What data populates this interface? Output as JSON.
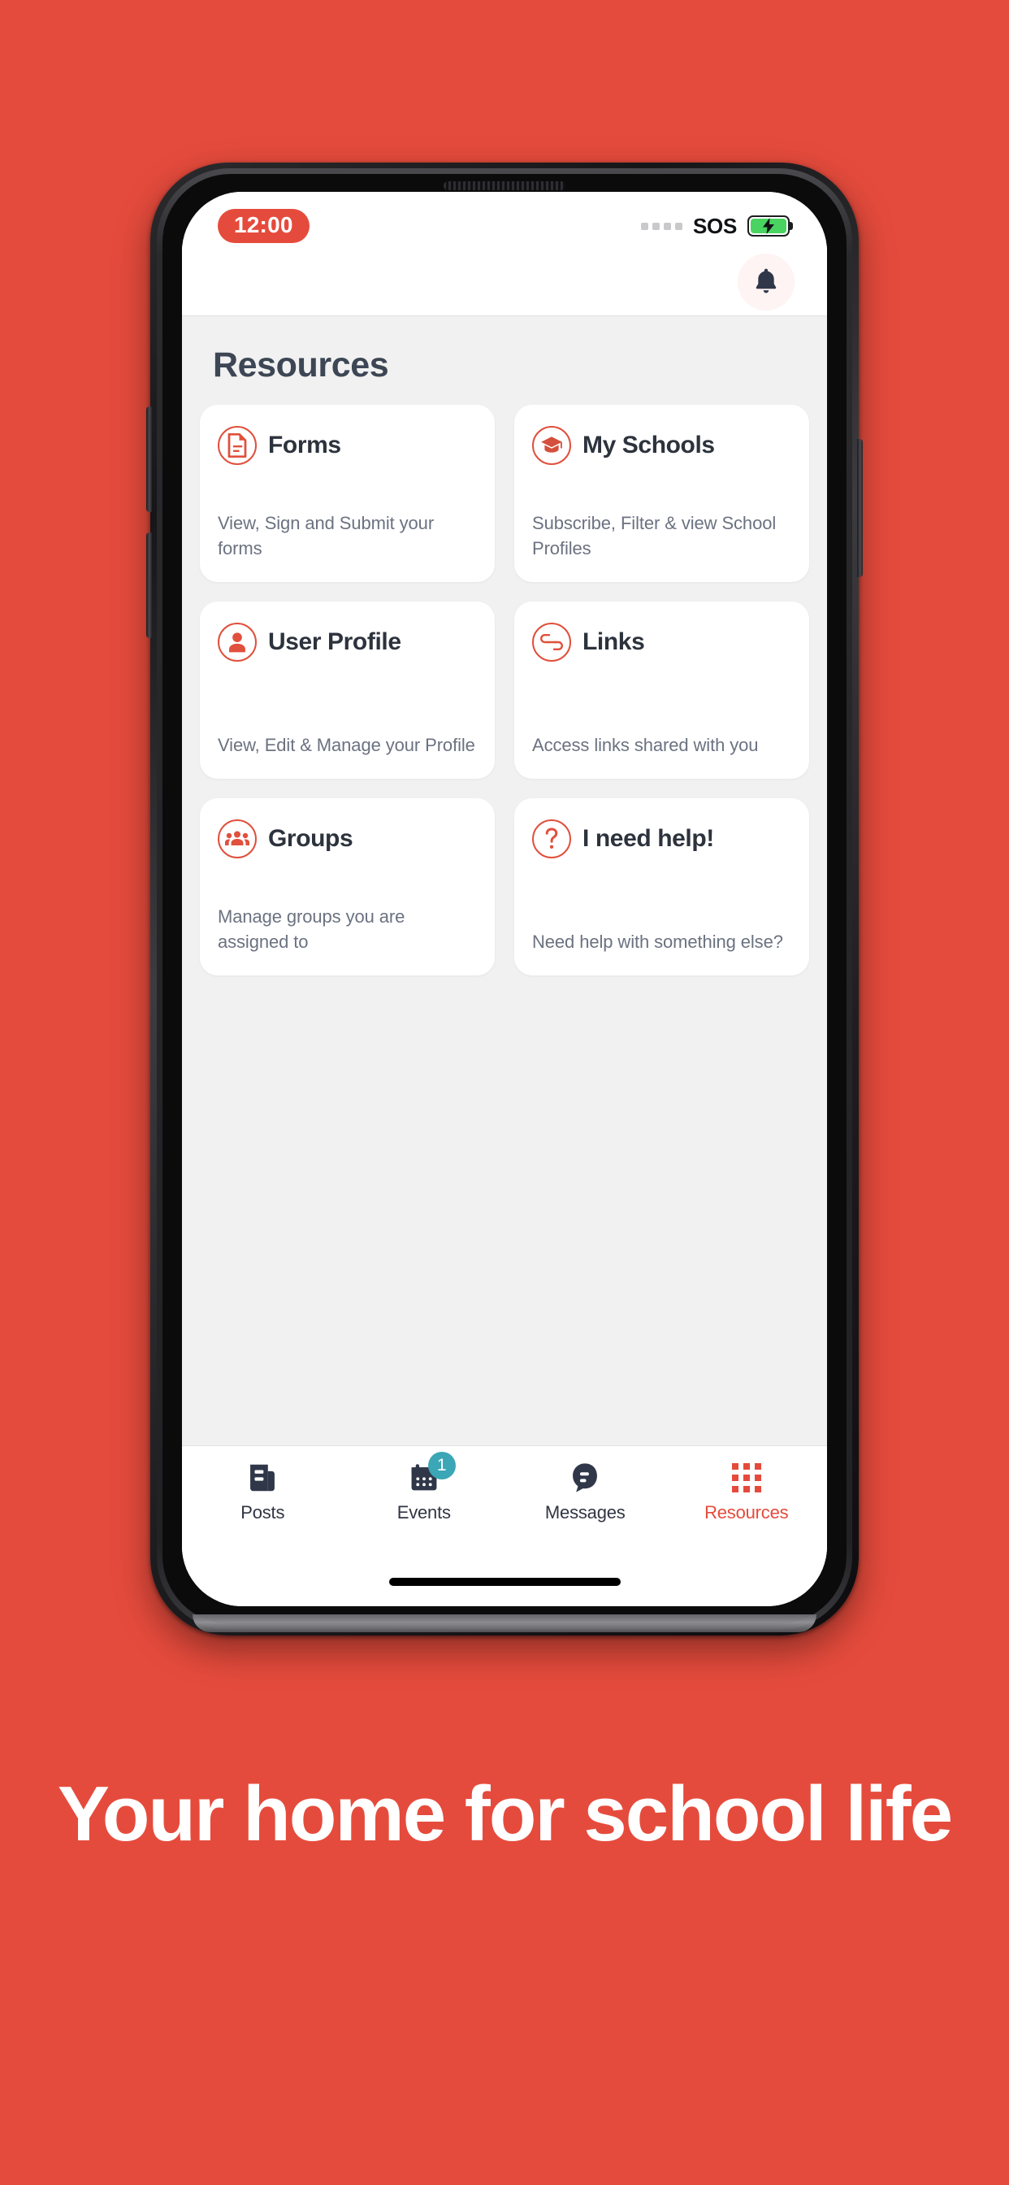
{
  "theme": {
    "brand_red": "#E54B3C",
    "icon_red": "#E0503C",
    "badge_teal": "#3BA6B5",
    "text_dark": "#2d333d",
    "text_muted": "#6b7280",
    "screen_bg": "#f1f1f1"
  },
  "status_bar": {
    "time": "12:00",
    "signal_icon": "signal-dots-icon",
    "sos_label": "SOS",
    "battery_icon": "battery-charging-icon",
    "battery_state": "charging"
  },
  "nav": {
    "notification_icon": "bell-icon"
  },
  "main": {
    "title": "Resources",
    "cards": [
      {
        "icon": "document-icon",
        "title": "Forms",
        "description": "View, Sign and Submit your forms"
      },
      {
        "icon": "graduation-cap-icon",
        "title": "My Schools",
        "description": "Subscribe, Filter & view School Profiles"
      },
      {
        "icon": "user-icon",
        "title": "User Profile",
        "description": "View, Edit & Manage your Profile"
      },
      {
        "icon": "link-icon",
        "title": "Links",
        "description": "Access links shared with you"
      },
      {
        "icon": "people-icon",
        "title": "Groups",
        "description": "Manage groups you are assigned to"
      },
      {
        "icon": "question-mark-icon",
        "title": "I need help!",
        "description": "Need help with something else?"
      }
    ]
  },
  "tab_bar": {
    "tabs": [
      {
        "label": "Posts",
        "icon": "news-icon",
        "badge": "",
        "active": false
      },
      {
        "label": "Events",
        "icon": "calendar-icon",
        "badge": "1",
        "active": false
      },
      {
        "label": "Messages",
        "icon": "chat-icon",
        "badge": "",
        "active": false
      },
      {
        "label": "Resources",
        "icon": "grid-icon",
        "badge": "",
        "active": true
      }
    ]
  },
  "promo": {
    "headline": "Your home for school life"
  }
}
